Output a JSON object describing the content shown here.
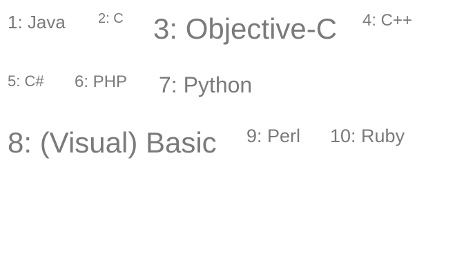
{
  "tag_cloud": {
    "text_color": "#7a7a7a",
    "items": [
      {
        "label": "1: Java"
      },
      {
        "label": "2: C"
      },
      {
        "label": "3: Objective-C"
      },
      {
        "label": "4: C++"
      },
      {
        "label": "5: C#"
      },
      {
        "label": "6: PHP"
      },
      {
        "label": "7: Python"
      },
      {
        "label": "8: (Visual) Basic"
      },
      {
        "label": "9: Perl"
      },
      {
        "label": "10: Ruby"
      }
    ]
  }
}
